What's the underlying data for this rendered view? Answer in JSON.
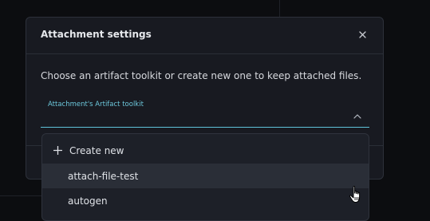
{
  "modal": {
    "title": "Attachment settings",
    "description": "Choose an artifact toolkit or create new one to keep attached files.",
    "close_icon": "close-icon"
  },
  "field": {
    "label": "Attachment's Artifact toolkit",
    "value": "",
    "chevron_icon": "chevron-up-icon"
  },
  "dropdown": {
    "create_label": "Create new",
    "create_icon": "plus-icon",
    "options": [
      {
        "label": "attach-file-test",
        "highlighted": true
      },
      {
        "label": "autogen",
        "highlighted": false
      }
    ]
  },
  "colors": {
    "accent": "#6cc7db",
    "modal_bg": "#181a21",
    "page_bg": "#0c0d10"
  }
}
